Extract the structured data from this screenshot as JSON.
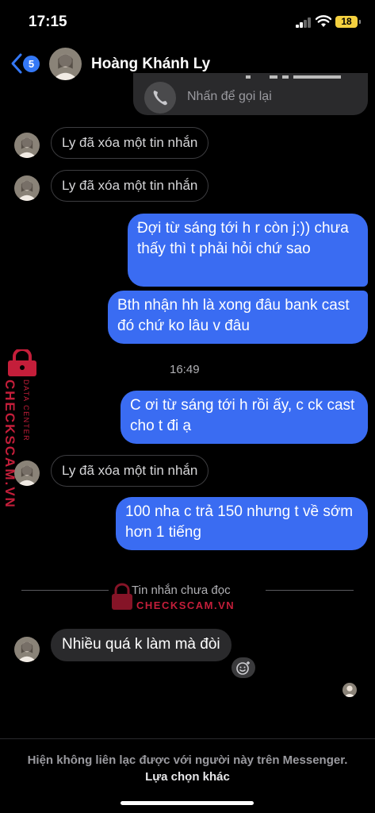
{
  "status": {
    "time": "17:15",
    "battery": "18"
  },
  "header": {
    "unread_count": "5",
    "contact_name": "Hoàng Khánh Ly"
  },
  "call_card": {
    "action_text": "Nhấn để gọi lại"
  },
  "messages": {
    "deleted_1": "Ly đã xóa một tin nhắn",
    "deleted_2": "Ly đã xóa một tin nhắn",
    "sent_1": "Đợi từ sáng tới h r còn j:)) chưa thấy thì t phải hỏi chứ sao",
    "sent_2": "Bth nhận hh là xong đâu bank cast đó chứ ko lâu v đâu",
    "timestamp": "16:49",
    "sent_3": "C ơi từ sáng tới h rồi ấy, c ck cast cho t đi ạ",
    "deleted_3": "Ly đã xóa một tin nhắn",
    "sent_4": "100 nha c trả 150 nhưng t về sớm hơn 1 tiếng",
    "unread_divider": "Tin nhắn chưa đọc",
    "received_1": "Nhiều quá k làm mà đòi"
  },
  "footer": {
    "notice": "Hiện không liên lạc được với người này trên Messenger.",
    "link": "Lựa chọn khác"
  },
  "watermark": {
    "brand": "CHECKSCAM.VN",
    "sub": "DATA CENTER",
    "center": "CHECKSCAM.VN"
  },
  "colors": {
    "sent_bubble": "#3a6cf2",
    "received_bubble": "#2a2a2c",
    "accent": "#3478f6",
    "watermark": "#c41e3a"
  }
}
